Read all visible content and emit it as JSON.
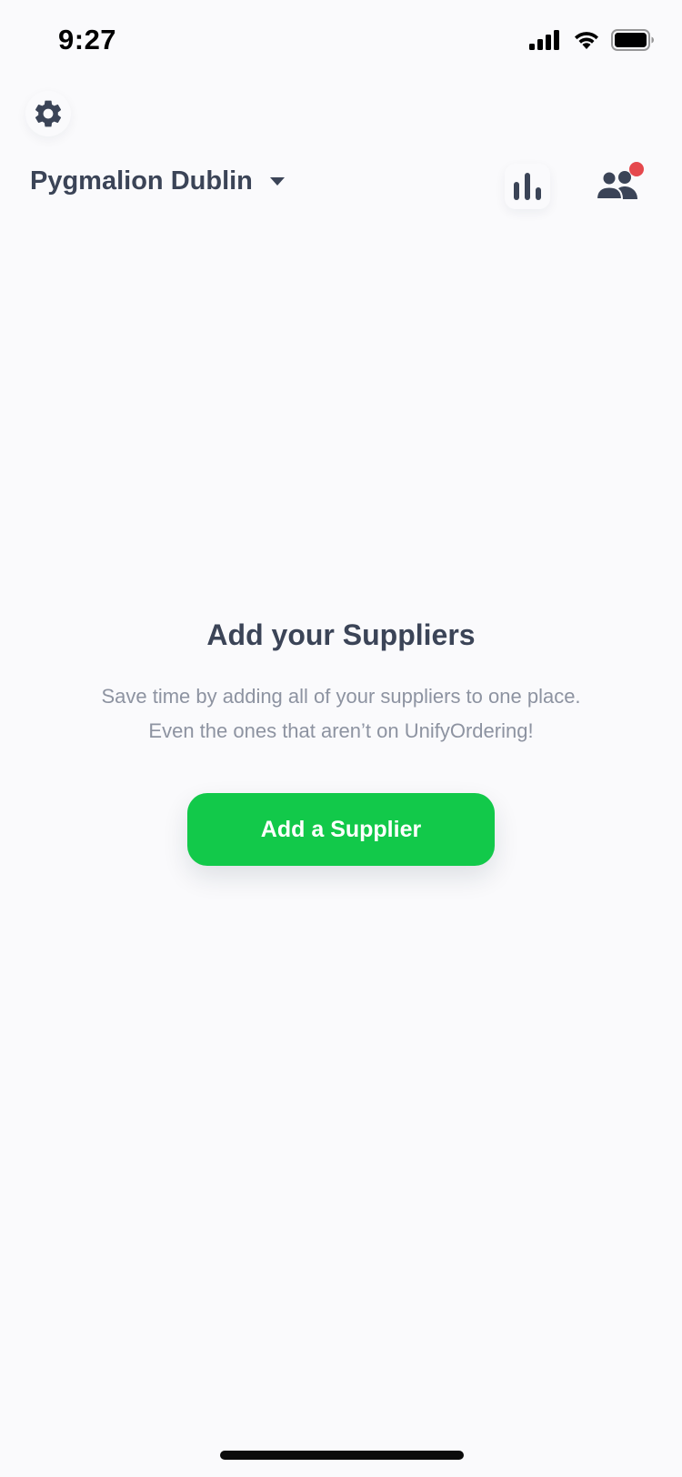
{
  "status_bar": {
    "time": "9:27"
  },
  "header": {
    "location_name": "Pygmalion Dublin",
    "icons": {
      "settings": "gear-icon",
      "dropdown": "caret-down-icon",
      "analytics": "bar-chart-icon",
      "team": "users-icon"
    },
    "notification_dot_color": "#e5484d"
  },
  "empty_state": {
    "title": "Add your Suppliers",
    "description_line1": "Save time by adding all of your suppliers to one place.",
    "description_line2": "Even the ones that aren’t on UnifyOrdering!",
    "button_label": "Add a Supplier"
  },
  "colors": {
    "accent": "#12c94a",
    "text_primary": "#3b4457",
    "text_secondary": "#8d93a1",
    "background": "#fafafc"
  }
}
